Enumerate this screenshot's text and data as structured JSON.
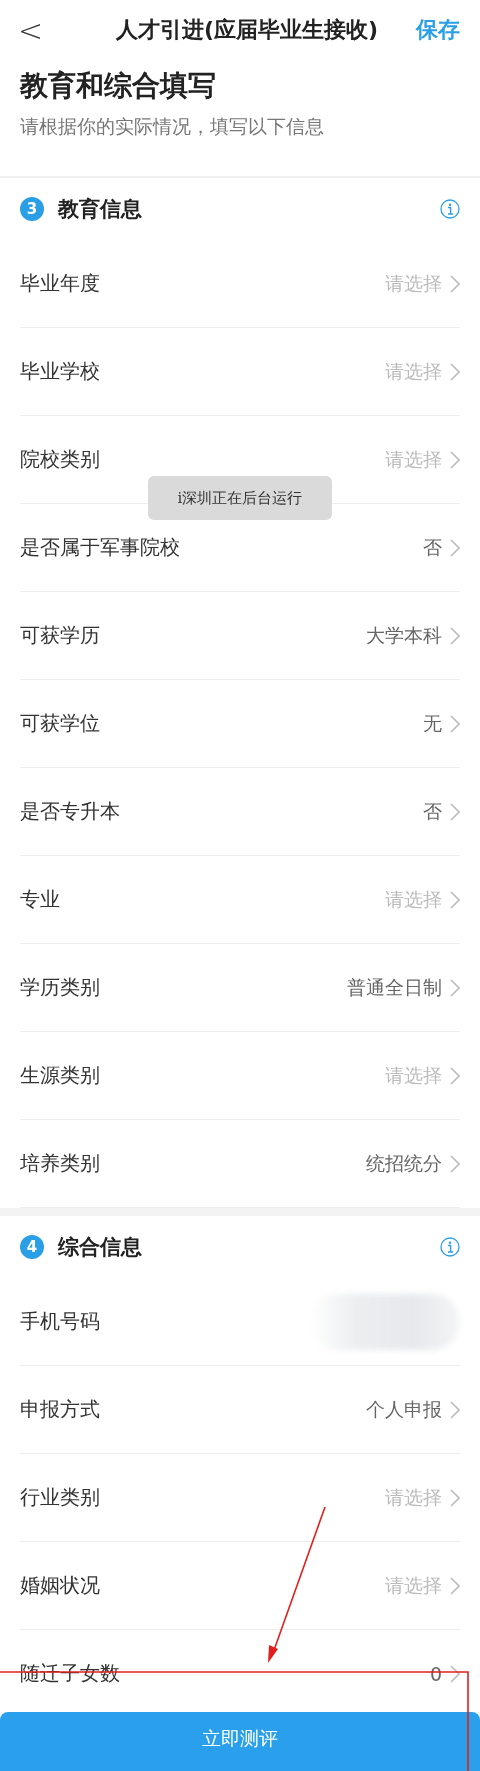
{
  "header": {
    "back": "<",
    "title": "人才引进(应届毕业生接收)",
    "action": "保存"
  },
  "page_title": "教育和综合填写",
  "subtitle": "请根据你的实际情况，填写以下信息",
  "sections": [
    {
      "number": "3",
      "title": "教育信息",
      "rows": [
        {
          "label": "毕业年度",
          "placeholder": "请选择"
        },
        {
          "label": "毕业学校",
          "placeholder": "请选择"
        },
        {
          "label": "院校类别",
          "placeholder": "请选择"
        },
        {
          "label": "是否属于军事院校",
          "value": "否"
        },
        {
          "label": "可获学历",
          "value": "大学本科"
        },
        {
          "label": "可获学位",
          "value": "无"
        },
        {
          "label": "是否专升本",
          "value": "否"
        },
        {
          "label": "专业",
          "placeholder": "请选择"
        },
        {
          "label": "学历类别",
          "value": "普通全日制"
        },
        {
          "label": "生源类别",
          "placeholder": "请选择"
        },
        {
          "label": "培养类别",
          "value": "统招统分"
        }
      ]
    },
    {
      "number": "4",
      "title": "综合信息",
      "rows": [
        {
          "label": "手机号码",
          "kind": "redacted"
        },
        {
          "label": "申报方式",
          "value": "个人申报"
        },
        {
          "label": "行业类别",
          "placeholder": "请选择"
        },
        {
          "label": "婚姻状况",
          "placeholder": "请选择"
        },
        {
          "label": "随迁子女数",
          "value": "0"
        }
      ]
    }
  ],
  "toast": "i深圳正在后台运行",
  "submit": "立即测评"
}
